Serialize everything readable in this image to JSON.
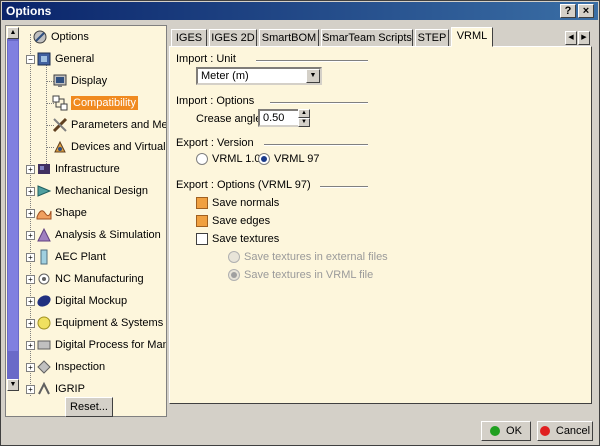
{
  "window": {
    "title": "Options",
    "help_btn": "?",
    "close_btn": "×"
  },
  "tree": {
    "items": [
      {
        "label": "Options"
      },
      {
        "label": "General"
      },
      {
        "label": "Display"
      },
      {
        "label": "Compatibility"
      },
      {
        "label": "Parameters and Measur"
      },
      {
        "label": "Devices and Virtual Rea"
      },
      {
        "label": "Infrastructure"
      },
      {
        "label": "Mechanical Design"
      },
      {
        "label": "Shape"
      },
      {
        "label": "Analysis & Simulation"
      },
      {
        "label": "AEC Plant"
      },
      {
        "label": "NC Manufacturing"
      },
      {
        "label": "Digital Mockup"
      },
      {
        "label": "Equipment & Systems"
      },
      {
        "label": "Digital Process for Manufac"
      },
      {
        "label": "Inspection"
      },
      {
        "label": "IGRIP"
      }
    ],
    "selected": "Compatibility"
  },
  "tabs": [
    "IGES",
    "IGES 2D",
    "SmartBOM",
    "SmarTeam Scripts",
    "STEP",
    "VRML"
  ],
  "active_tab": "VRML",
  "import_unit": {
    "title": "Import : Unit",
    "value": "Meter (m)"
  },
  "import_options": {
    "title": "Import : Options",
    "crease_label": "Crease angle :",
    "crease_value": "0.50"
  },
  "export_version": {
    "title": "Export : Version",
    "opt1": "VRML 1.0",
    "opt2": "VRML 97",
    "selected": "VRML 97"
  },
  "export_options": {
    "title": "Export : Options (VRML 97)",
    "save_normals": "Save normals",
    "save_edges": "Save edges",
    "save_textures": "Save textures",
    "tex_external": "Save textures in external files",
    "tex_vrml": "Save textures in VRML file"
  },
  "buttons": {
    "reset": "Reset...",
    "ok": "OK",
    "cancel": "Cancel"
  },
  "colors": {
    "accent_selected": "#f08a20",
    "title_bar": "#0a246a",
    "panel_bg": "#fdf6dc"
  }
}
